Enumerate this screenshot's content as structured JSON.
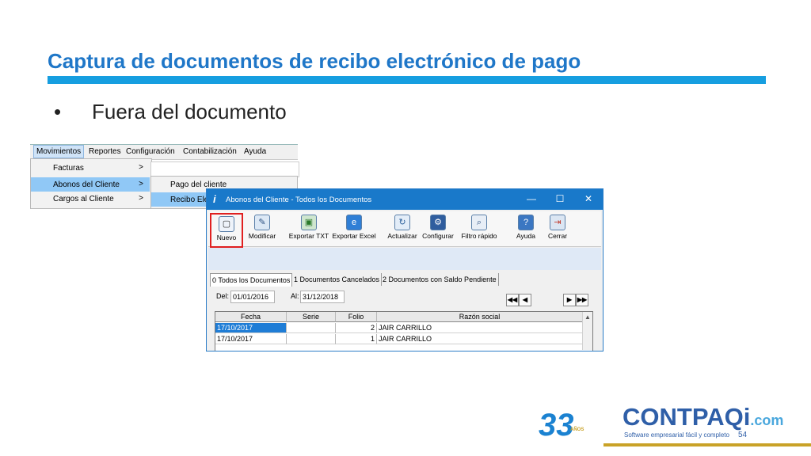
{
  "slide": {
    "title": "Captura de documentos de recibo electrónico de pago",
    "bullet_symbol": "•",
    "bullet_text": "Fuera del documento"
  },
  "menu": {
    "items": [
      "Movimientos",
      "Reportes",
      "Configuración",
      "Contabilización",
      "Ayuda"
    ],
    "submenu": [
      "Facturas",
      "Abonos del Cliente",
      "Cargos al Cliente"
    ],
    "submenu_arrow": ">",
    "subsubmenu": [
      "Pago del cliente",
      "Recibo Elec"
    ]
  },
  "window": {
    "title": "Abonos del Cliente - Todos los Documentos",
    "controls": {
      "minimize": "—",
      "maximize": "☐",
      "close": "✕"
    },
    "toolbar": [
      "Nuevo",
      "Modificar",
      "Exportar TXT",
      "Exportar Excel",
      "Actualizar",
      "Configurar",
      "Filtro rápido",
      "Ayuda",
      "Cerrar"
    ],
    "tabs": [
      "0 Todos los Documentos",
      "1 Documentos Cancelados",
      "2 Documentos con Saldo Pendiente"
    ],
    "filter": {
      "del_label": "Del:",
      "del_value": "01/01/2016",
      "al_label": "Al:",
      "al_value": "31/12/2018"
    },
    "nav": {
      "first": "◀◀",
      "prev": "◀",
      "next": "▶",
      "last": "▶▶"
    },
    "grid": {
      "columns": [
        "Fecha",
        "Serie",
        "Folio",
        "Razón social"
      ],
      "rows": [
        [
          "17/10/2017",
          "",
          "2",
          "JAIR CARRILLO"
        ],
        [
          "17/10/2017",
          "",
          "1",
          "JAIR CARRILLO"
        ]
      ]
    }
  },
  "footer": {
    "anniv_number": "33",
    "anniv_label": "AÑOS",
    "brand": "CONTPAQi",
    "brand_suffix": ".com",
    "tagline": "Software empresarial fácil y completo",
    "page_number": "54"
  },
  "colors": {
    "title": "#1f77c8",
    "title_bar": "#169ee0",
    "window_titlebar": "#1979ca",
    "highlight_box": "#e02020",
    "brand": "#2f5fa8"
  }
}
